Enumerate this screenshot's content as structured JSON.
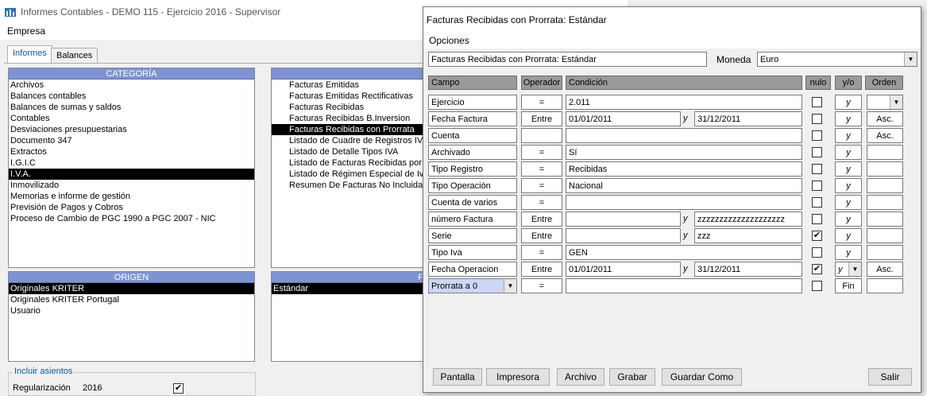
{
  "back": {
    "title": "Informes Contables - DEMO 115 - Ejercicio 2016 - Supervisor",
    "menu": "Empresa",
    "tabs": [
      "Informes",
      "Balances"
    ],
    "categoria_header": "CATEGORÍA",
    "categorias": [
      "Archivos",
      "Balances contables",
      "Balances de sumas y saldos",
      "Contables",
      "Desviaciones presupuestarias",
      "Documento 347",
      "Extractos",
      "I.G.I.C",
      "I.V.A.",
      "Inmovilizado",
      "Memorias e informe de gestión",
      "Previsión de Pagos y Cobros",
      "Proceso de Cambio de PGC 1990 a PGC 2007 - NIC"
    ],
    "categoria_selected": 8,
    "informes": [
      "Facturas Emitidas",
      "Facturas Emitidas Rectificativas",
      "Facturas Recibidas",
      "Facturas Recibidas B.Inversion",
      "Facturas Recibidas con Prorrata",
      "Listado de Cuadre de Registros IVA",
      "Listado de Detalle Tipos IVA",
      "Listado de Facturas Recibidas por N",
      "Listado de Régimen Especial de Iva",
      "Resumen De Facturas No Incluidas"
    ],
    "informe_selected": 4,
    "origen_header": "ORIGEN",
    "origenes": [
      "Originales KRITER",
      "Originales KRITER Portugal",
      "Usuario"
    ],
    "origen_selected": 0,
    "formato_header": "F",
    "formatos": [
      "Estándar"
    ],
    "incluir_label": "Incluir asientos",
    "regularizacion_label": "Regularización",
    "regularizacion_year": "2016",
    "regularizacion_checked": "✔"
  },
  "dialog": {
    "title": "Facturas Recibidas con Prorrata: Estándar",
    "menu": "Opciones",
    "name_value": "Facturas Recibidas con Prorrata: Estándar",
    "moneda_label": "Moneda",
    "moneda_value": "Euro",
    "headers": {
      "campo": "Campo",
      "operador": "Operador",
      "condicion": "Condición",
      "nulo": "nulo",
      "yo": "y/o",
      "orden": "Orden"
    },
    "rows": [
      {
        "campo": "Ejercicio",
        "operador": "=",
        "v1": "2.011",
        "y": "",
        "v2": "",
        "nulo": "",
        "yo": "y",
        "orden": ""
      },
      {
        "campo": "Fecha Factura",
        "operador": "Entre",
        "v1": "01/01/2011",
        "y": "y",
        "v2": "31/12/2011",
        "nulo": "",
        "yo": "y",
        "orden": "Asc."
      },
      {
        "campo": "Cuenta",
        "operador": "",
        "v1": "",
        "y": "",
        "v2": "",
        "nulo": "",
        "yo": "y",
        "orden": "Asc."
      },
      {
        "campo": "Archivado",
        "operador": "=",
        "v1": "Sí",
        "y": "",
        "v2": "",
        "nulo": "",
        "yo": "y",
        "orden": ""
      },
      {
        "campo": "Tipo Registro",
        "operador": "=",
        "v1": "Recibidas",
        "y": "",
        "v2": "",
        "nulo": "",
        "yo": "y",
        "orden": ""
      },
      {
        "campo": "Tipo Operación",
        "operador": "=",
        "v1": "Nacional",
        "y": "",
        "v2": "",
        "nulo": "",
        "yo": "y",
        "orden": ""
      },
      {
        "campo": "Cuenta de varios",
        "operador": "=",
        "v1": "",
        "y": "",
        "v2": "",
        "nulo": "",
        "yo": "y",
        "orden": ""
      },
      {
        "campo": "número Factura",
        "operador": "Entre",
        "v1": "",
        "y": "y",
        "v2": "zzzzzzzzzzzzzzzzzzzz",
        "nulo": "",
        "yo": "y",
        "orden": ""
      },
      {
        "campo": "Serie",
        "operador": "Entre",
        "v1": "",
        "y": "y",
        "v2": "zzz",
        "nulo": "✔",
        "yo": "y",
        "orden": ""
      },
      {
        "campo": "Tipo Iva",
        "operador": "=",
        "v1": "GEN",
        "y": "",
        "v2": "",
        "nulo": "",
        "yo": "y",
        "orden": ""
      },
      {
        "campo": "Fecha Operacion",
        "operador": "Entre",
        "v1": "01/01/2011",
        "y": "y",
        "v2": "31/12/2011",
        "nulo": "✔",
        "yo": "y",
        "orden": "Asc."
      },
      {
        "campo": "Prorrata a 0",
        "operador": "=",
        "v1": "",
        "y": "",
        "v2": "",
        "nulo": "",
        "yo": "Fin",
        "orden": ""
      }
    ],
    "buttons": [
      "Pantalla",
      "Impresora",
      "Archivo",
      "Grabar",
      "Guardar Como",
      "Salir"
    ]
  }
}
